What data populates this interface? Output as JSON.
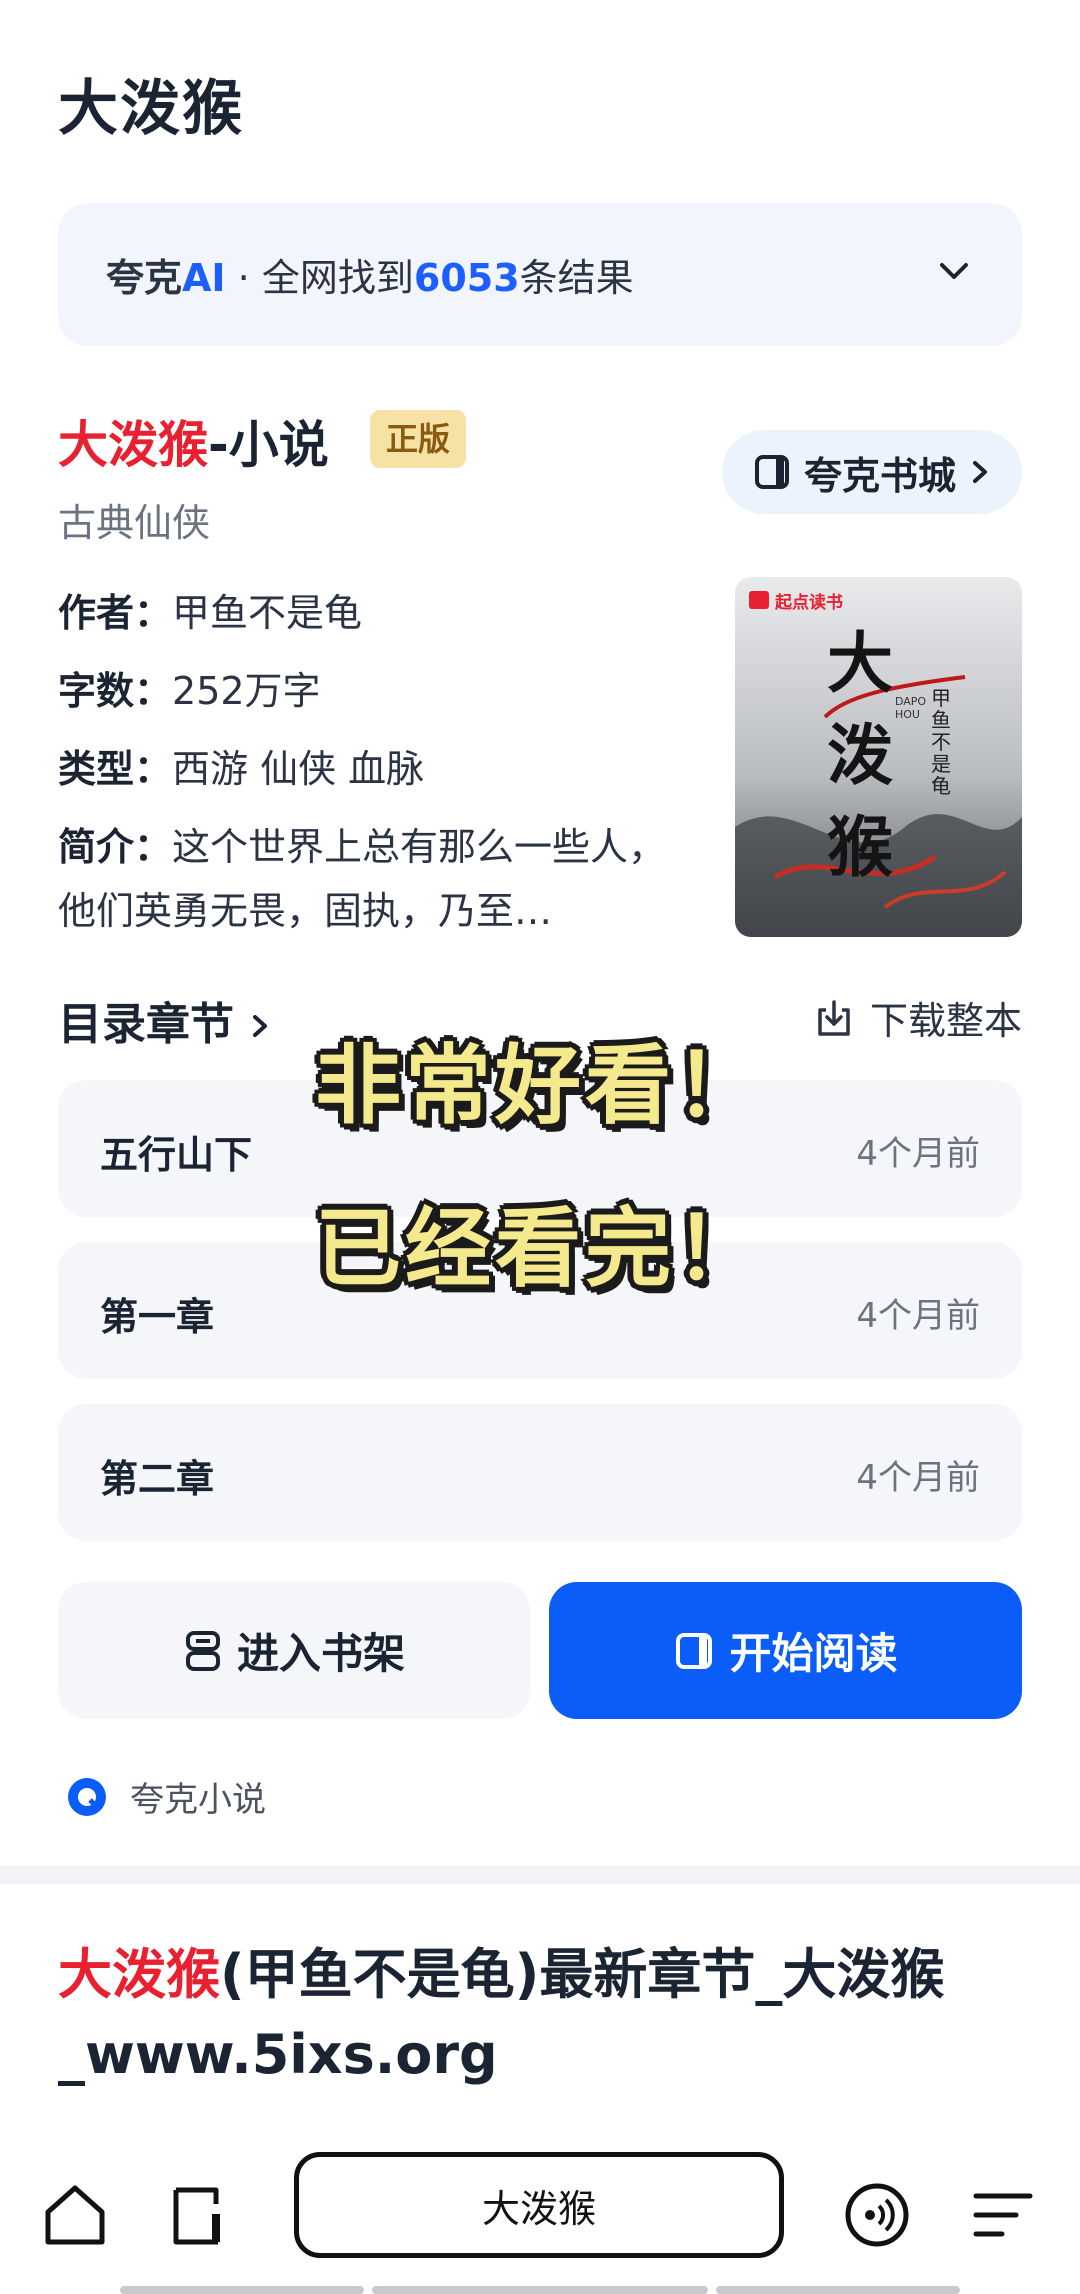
{
  "header": {
    "title": "大泼猴"
  },
  "ai_summary": {
    "brand_prefix": "夸克",
    "brand_ai": "AI",
    "separator": "·",
    "text_before": "全网找到",
    "count": "6053",
    "text_after": "条结果"
  },
  "book": {
    "title_red": "大泼猴",
    "title_suffix": "-小说",
    "badge": "正版",
    "genre": "古典仙侠",
    "store_button": "夸克书城",
    "author_label": "作者：",
    "author": "甲鱼不是龟",
    "words_label": "字数：",
    "words": "252万字",
    "type_label": "类型：",
    "types": "西游 仙侠 血脉",
    "intro_label": "简介：",
    "intro": "这个世界上总有那么一些人，他们英勇无畏，固执，乃至…",
    "cover": {
      "publisher": "起点读书",
      "title": "大泼猴",
      "author": "甲鱼不是龟",
      "latin": "DAPO HOU"
    }
  },
  "toc": {
    "title": "目录章节",
    "download": "下载整本",
    "chapters": [
      {
        "name": "五行山下",
        "time": "4个月前"
      },
      {
        "name": "第一章",
        "time": "4个月前"
      },
      {
        "name": "第二章",
        "time": "4个月前"
      }
    ]
  },
  "overlay": {
    "line1": "非常好看！",
    "line2": "已经看完！"
  },
  "actions": {
    "shelf": "进入书架",
    "read": "开始阅读"
  },
  "source": {
    "name": "夸克小说"
  },
  "result": {
    "title_red": "大泼猴",
    "title_rest": "(甲鱼不是龟)最新章节_大泼猴_www.5ixs.org"
  },
  "bottom_nav": {
    "search_text": "大泼猴"
  },
  "colors": {
    "accent_blue": "#0a5ef7",
    "title_red": "#e8202f",
    "badge_bg": "#f7e2a6"
  }
}
